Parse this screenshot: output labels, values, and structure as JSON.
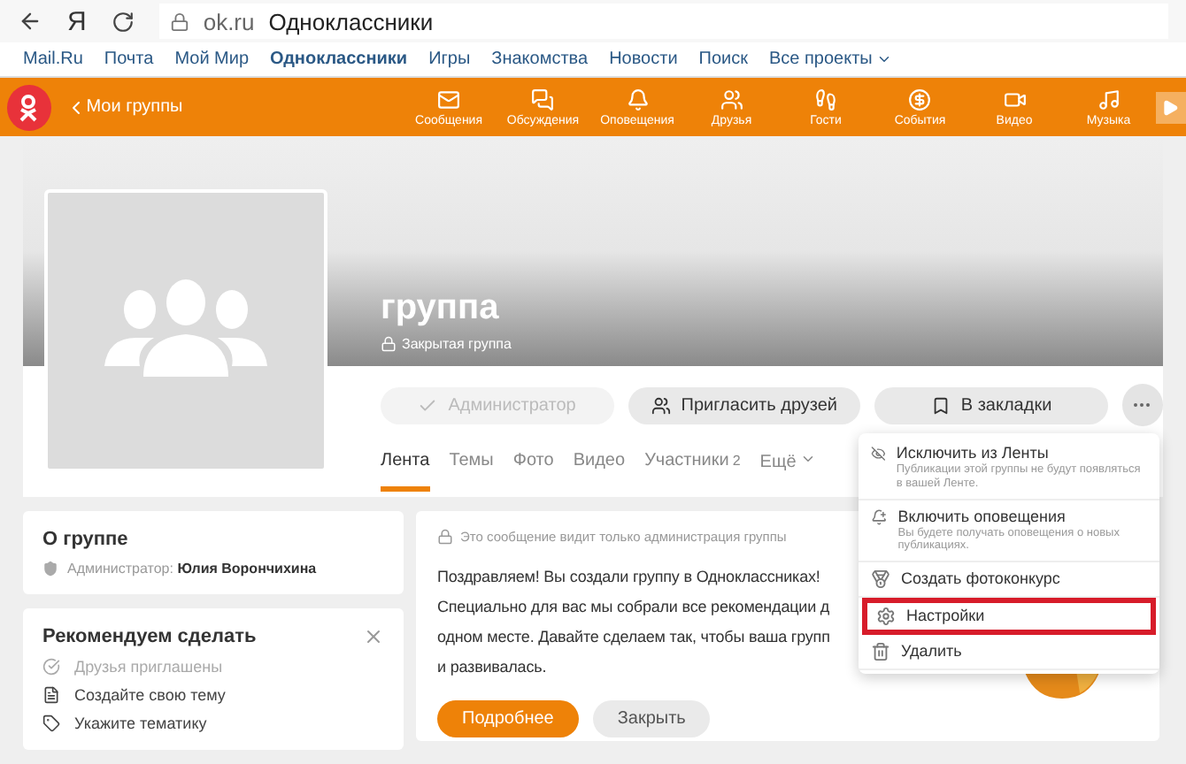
{
  "browser": {
    "logo": "Я",
    "domain": "ok.ru",
    "title": "Одноклассники"
  },
  "portal_links": [
    {
      "label": "Mail.Ru",
      "selected": false
    },
    {
      "label": "Почта",
      "selected": false
    },
    {
      "label": "Мой Мир",
      "selected": false
    },
    {
      "label": "Одноклассники",
      "selected": true
    },
    {
      "label": "Игры",
      "selected": false
    },
    {
      "label": "Знакомства",
      "selected": false
    },
    {
      "label": "Новости",
      "selected": false
    },
    {
      "label": "Поиск",
      "selected": false
    },
    {
      "label": "Все проекты",
      "selected": false
    }
  ],
  "nav": {
    "section": "Мои группы",
    "items": [
      {
        "label": "Сообщения",
        "kind": "mail"
      },
      {
        "label": "Обсуждения",
        "kind": "chat"
      },
      {
        "label": "Оповещения",
        "kind": "bell"
      },
      {
        "label": "Друзья",
        "kind": "friends"
      },
      {
        "label": "Гости",
        "kind": "guests"
      },
      {
        "label": "События",
        "kind": "events"
      },
      {
        "label": "Видео",
        "kind": "video"
      },
      {
        "label": "Музыка",
        "kind": "music"
      }
    ]
  },
  "group": {
    "name": "группа",
    "privacy": "Закрытая группа"
  },
  "actions": [
    {
      "label": "Администратор",
      "kind": "admin",
      "disabled": true
    },
    {
      "label": "Пригласить друзей",
      "kind": "invite",
      "disabled": false
    },
    {
      "label": "В закладки",
      "kind": "bookmark",
      "disabled": false
    }
  ],
  "tabs": [
    {
      "label": "Лента",
      "selected": true
    },
    {
      "label": "Темы",
      "selected": false
    },
    {
      "label": "Фото",
      "selected": false
    },
    {
      "label": "Видео",
      "selected": false
    },
    {
      "label": "Участники",
      "count": "2",
      "selected": false
    },
    {
      "label": "Ещё",
      "selected": false,
      "kind": "more"
    }
  ],
  "about": {
    "title": "О группе",
    "admin_label": "Администратор:",
    "admin_name": "Юлия Ворончихина"
  },
  "recommend": {
    "title": "Рекомендуем сделать",
    "items": [
      {
        "label": "Друзья приглашены",
        "kind": "check",
        "done": true
      },
      {
        "label": "Создайте свою тему",
        "kind": "topic",
        "done": false
      },
      {
        "label": "Укажите тематику",
        "kind": "tags",
        "done": false
      }
    ]
  },
  "notice": {
    "note": "Это сообщение видит только администрация группы",
    "lines": [
      "Поздравляем! Вы создали группу в Одноклассниках!",
      "Специально для вас мы собрали все рекомендации д",
      "одном месте. Давайте сделаем так, чтобы ваша групп",
      "и развивалась."
    ],
    "buttons": [
      {
        "label": "Подробнее",
        "kind": "primary"
      },
      {
        "label": "Закрыть",
        "kind": "secondary"
      }
    ]
  },
  "menu": [
    {
      "title": "Исключить из Ленты",
      "desc": "Публикации этой группы не будут появляться в вашей Ленте.",
      "kind": "hide",
      "highlighted": false
    },
    {
      "title": "Включить оповещения",
      "desc": "Вы будете получать оповещения о новых публикациях.",
      "kind": "notify",
      "highlighted": false
    },
    {
      "title": "Создать фотоконкурс",
      "kind": "contest",
      "highlighted": false
    },
    {
      "title": "Настройки",
      "kind": "settings",
      "highlighted": true
    },
    {
      "title": "Удалить",
      "kind": "delete",
      "highlighted": false
    }
  ]
}
